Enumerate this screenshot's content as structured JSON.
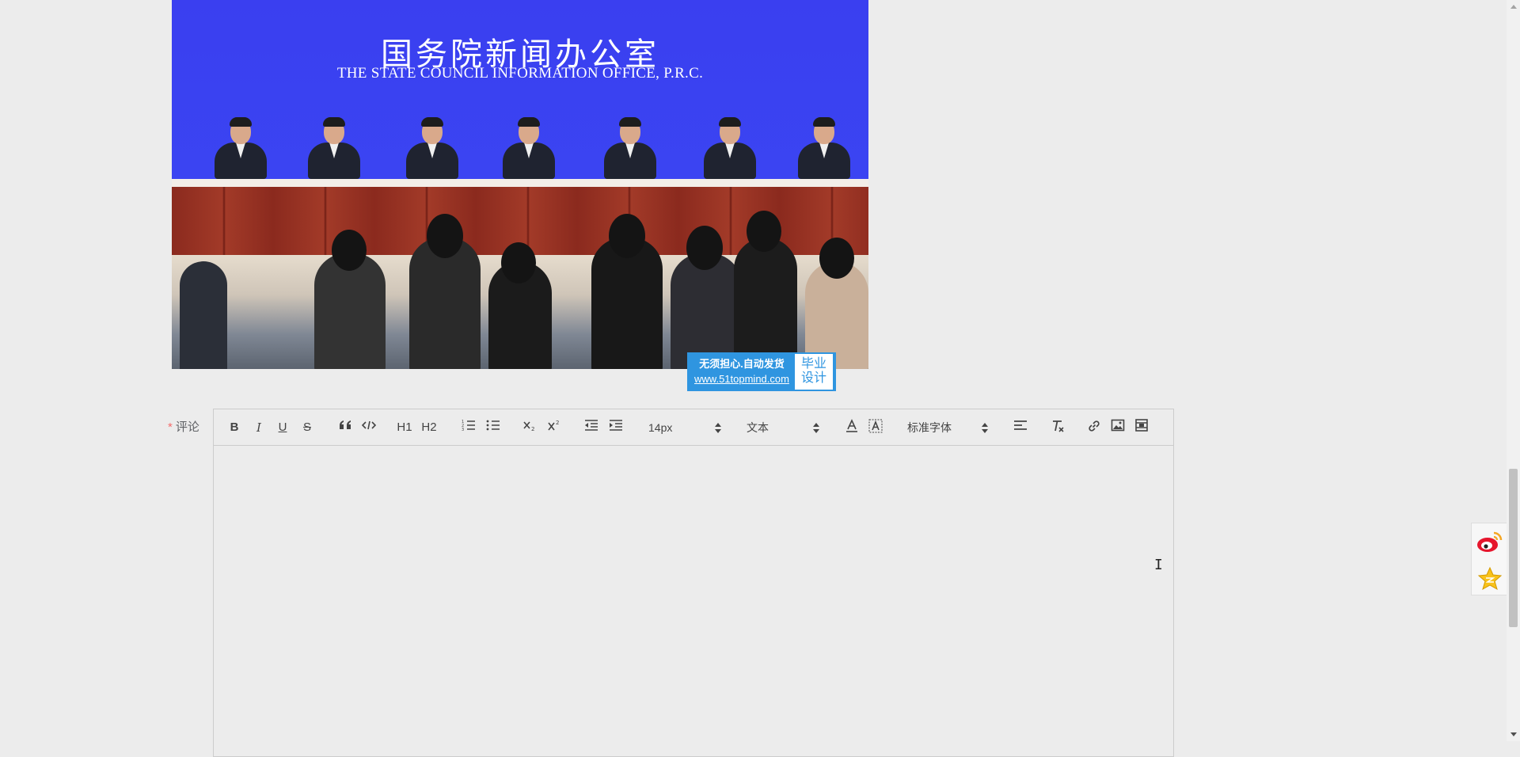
{
  "photo": {
    "title_cn": "国务院新闻办公室",
    "title_en": "THE STATE COUNCIL INFORMATION OFFICE, P.R.C."
  },
  "badge": {
    "line1": "无须担心.自动发货",
    "url": "www.51topmind.com",
    "right_line1": "毕业",
    "right_line2": "设计"
  },
  "comment": {
    "required_mark": "*",
    "label": "评论",
    "toolbar": {
      "bold": "B",
      "italic": "I",
      "underline": "U",
      "strike": "S",
      "h1": "H1",
      "h2": "H2",
      "font_size": "14px",
      "paragraph": "文本",
      "font_family": "标准字体"
    }
  },
  "colors": {
    "required": "#f56c6c",
    "badge_blue": "#2f95e0",
    "backdrop_blue": "#3b45f2"
  }
}
